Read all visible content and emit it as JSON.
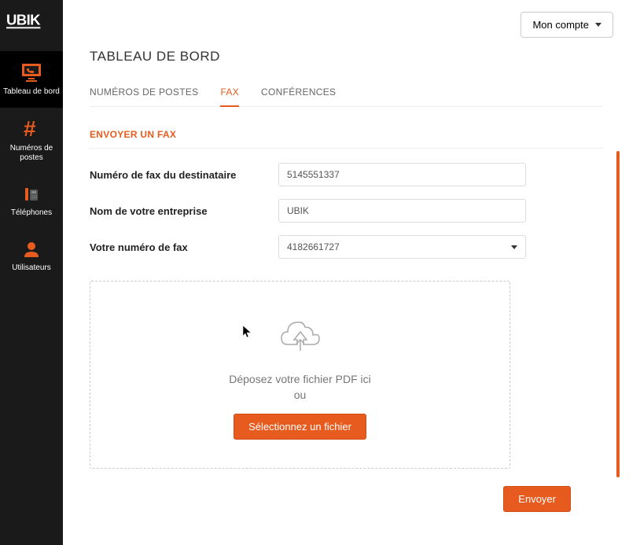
{
  "brand": "UBIK",
  "account_button": "Mon compte",
  "page_title": "TABLEAU DE BORD",
  "sidebar": {
    "items": [
      {
        "label": "Tableau de bord"
      },
      {
        "label": "Numéros de postes"
      },
      {
        "label": "Téléphones"
      },
      {
        "label": "Utilisateurs"
      }
    ]
  },
  "tabs": [
    {
      "label": "NUMÉROS DE POSTES"
    },
    {
      "label": "FAX"
    },
    {
      "label": "CONFÉRENCES"
    }
  ],
  "section_title": "ENVOYER UN FAX",
  "form": {
    "recipient_label": "Numéro de fax du destinataire",
    "recipient_value": "5145551337",
    "company_label": "Nom de votre entreprise",
    "company_value": "UBIK",
    "your_fax_label": "Votre numéro de fax",
    "your_fax_value": "4182661727"
  },
  "dropzone": {
    "line1": "Déposez votre fichier PDF ici",
    "line2": "ou",
    "button": "Sélectionnez un fichier"
  },
  "submit_label": "Envoyer",
  "colors": {
    "accent": "#e85b1e"
  }
}
